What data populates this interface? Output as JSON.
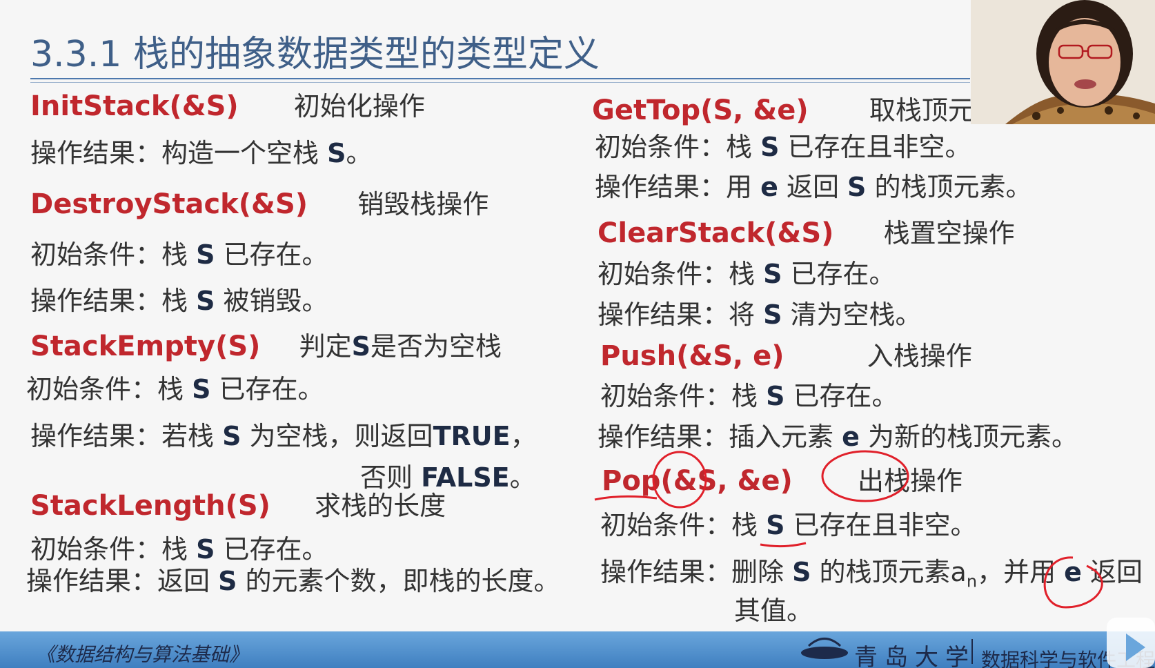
{
  "slide": {
    "title": "3.3.1 栈的抽象数据类型的类型定义",
    "left": [
      {
        "op": "InitStack(&S)",
        "desc": "初始化操作"
      },
      {
        "prefix": "操作结果：构造一个空栈 ",
        "s": "S",
        "suffix": "。"
      },
      {
        "op": "DestroyStack(&S)",
        "desc": "销毁栈操作"
      },
      {
        "prefix": "初始条件：栈 ",
        "s": "S",
        "suffix": " 已存在。"
      },
      {
        "prefix": "操作结果：栈 ",
        "s": "S",
        "suffix": " 被销毁。"
      },
      {
        "op": "StackEmpty(S)",
        "desc_a": "判定",
        "desc_s": "S",
        "desc_b": "是否为空栈"
      },
      {
        "prefix": "初始条件：栈 ",
        "s": "S",
        "suffix": " 已存在。"
      },
      {
        "prefix": "操作结果：若栈 ",
        "s": "S",
        "mid": " 为空栈，则返回",
        "tv": "TRUE",
        "end": "，"
      },
      {
        "pre": "否则 ",
        "fv": "FALSE",
        "end": "。"
      },
      {
        "op": "StackLength(S)",
        "desc": "求栈的长度"
      },
      {
        "prefix": "初始条件：栈 ",
        "s": "S",
        "suffix": " 已存在。"
      },
      {
        "prefix": "操作结果：返回 ",
        "s": "S",
        "suffix": " 的元素个数，即栈的长度。"
      }
    ],
    "right": [
      {
        "op": "GetTop(S, &e)",
        "desc": "取栈顶元素"
      },
      {
        "prefix": "初始条件：栈 ",
        "s": "S",
        "suffix": " 已存在且非空。"
      },
      {
        "prefix": "操作结果：用 ",
        "e": "e",
        "mid": " 返回 ",
        "s": "S",
        "suffix": " 的栈顶元素。"
      },
      {
        "op": "ClearStack(&S)",
        "desc": "栈置空操作"
      },
      {
        "prefix": "初始条件：栈 ",
        "s": "S",
        "suffix": " 已存在。"
      },
      {
        "prefix": "操作结果：将 ",
        "s": "S",
        "suffix": " 清为空栈。"
      },
      {
        "op": "Push(&S, e)",
        "desc": "入栈操作"
      },
      {
        "prefix": "初始条件：栈 ",
        "s": "S",
        "suffix": " 已存在。"
      },
      {
        "prefix": "操作结果：插入元素 ",
        "e": "e",
        "suffix": " 为新的栈顶元素。"
      },
      {
        "op": "Pop(&S, &e)",
        "desc": "出栈操作"
      },
      {
        "prefix": "初始条件：栈 ",
        "s": "S",
        "suffix": " 已存在且非空。"
      },
      {
        "prefix": "操作结果：删除 ",
        "s": "S",
        "mid": " 的栈顶元素a",
        "sub": "n",
        "mid2": "，并用 ",
        "e": "e",
        "suffix": " 返回"
      },
      {
        "text": "其值。"
      }
    ]
  },
  "footer": {
    "course": "《数据结构与算法基础》",
    "university": "青岛大学",
    "department": "数据科学与软件工程"
  },
  "colors": {
    "op_red": "#c0272d",
    "title_blue": "#3f5f88",
    "footer_blue": "#4a8bca",
    "annotation_red": "#e0202a"
  }
}
